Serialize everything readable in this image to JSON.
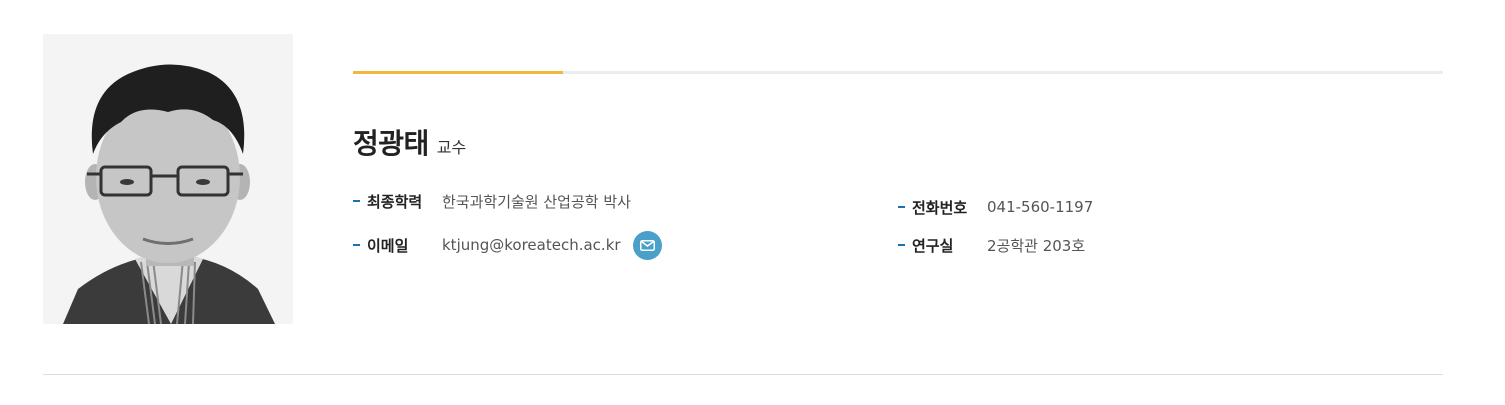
{
  "profile": {
    "name": "정광태",
    "title": "교수",
    "photo_alt": "portrait photo"
  },
  "details": {
    "education": {
      "label": "최종학력",
      "value": "한국과학기술원 산업공학 박사"
    },
    "email": {
      "label": "이메일",
      "value": "ktjung@koreatech.ac.kr",
      "icon": "mail-icon"
    },
    "phone": {
      "label": "전화번호",
      "value": "041-560-1197"
    },
    "office": {
      "label": "연구실",
      "value": "2공학관 203호"
    }
  },
  "colors": {
    "accent": "#f0b83c",
    "dash": "#1a73b0",
    "mail_button": "#4aa0c8"
  }
}
